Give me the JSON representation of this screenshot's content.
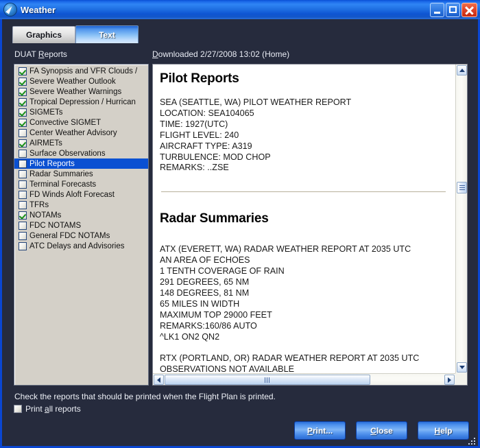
{
  "window": {
    "title": "Weather",
    "icon": "weather-compass-icon",
    "minimize_label": "Minimize",
    "maximize_label": "Maximize",
    "close_label": "Close",
    "accent_color": "#0a4fd4",
    "background_color": "#262b3d"
  },
  "tabs": [
    {
      "label": "Graphics",
      "active": false
    },
    {
      "label": "Text",
      "active": true
    }
  ],
  "labels": {
    "duat_reports": "DUAT Reports",
    "duat_reports_accel_prefix": "DUAT ",
    "duat_reports_accel_char": "R",
    "duat_reports_accel_suffix": "eports",
    "downloaded_accel_char": "D",
    "downloaded_rest": "ownloaded 2/27/2008 13:02 (Home)"
  },
  "report_list": {
    "selected_index": 9,
    "items": [
      {
        "label": "FA Synopsis and VFR Clouds / ",
        "checked": true
      },
      {
        "label": "Severe Weather Outlook",
        "checked": true
      },
      {
        "label": "Severe Weather Warnings",
        "checked": true
      },
      {
        "label": "Tropical Depression / Hurrican",
        "checked": true
      },
      {
        "label": "SIGMETs",
        "checked": true
      },
      {
        "label": "Convective SIGMET",
        "checked": true
      },
      {
        "label": "Center Weather Advisory",
        "checked": false
      },
      {
        "label": "AIRMETs",
        "checked": true
      },
      {
        "label": "Surface Observations",
        "checked": false
      },
      {
        "label": "Pilot Reports",
        "checked": false
      },
      {
        "label": "Radar Summaries",
        "checked": false
      },
      {
        "label": "Terminal Forecasts",
        "checked": false
      },
      {
        "label": "FD Winds Aloft Forecast",
        "checked": false
      },
      {
        "label": "TFRs",
        "checked": false
      },
      {
        "label": "NOTAMs",
        "checked": true
      },
      {
        "label": "FDC NOTAMS",
        "checked": false
      },
      {
        "label": "General FDC NOTAMs",
        "checked": false
      },
      {
        "label": "ATC Delays and Advisories",
        "checked": false
      }
    ]
  },
  "document": {
    "sections": [
      {
        "heading": "Pilot Reports",
        "lines": [
          "SEA (SEATTLE, WA) PILOT WEATHER REPORT",
          "LOCATION: SEA104065",
          "TIME: 1927(UTC)",
          "FLIGHT LEVEL: 240",
          "AIRCRAFT TYPE: A319",
          "TURBULENCE: MOD CHOP",
          "REMARKS: ..ZSE"
        ]
      },
      {
        "heading": "Radar Summaries",
        "lines": [
          "ATX (EVERETT, WA) RADAR WEATHER REPORT AT 2035 UTC",
          "AN AREA OF ECHOES",
          "1 TENTH COVERAGE OF RAIN",
          "291 DEGREES, 65 NM",
          "148 DEGREES, 81 NM",
          "65 MILES IN WIDTH",
          "MAXIMUM TOP 29000 FEET",
          "REMARKS:160/86 AUTO",
          "^LK1 ON2 QN2",
          "",
          "RTX (PORTLAND, OR) RADAR WEATHER REPORT AT 2035 UTC",
          "OBSERVATIONS NOT AVAILABLE"
        ]
      }
    ]
  },
  "scrollbars": {
    "vertical": {
      "thumb_top_pct": 37,
      "up_arrow": "scroll-up-icon",
      "down_arrow": "scroll-down-icon"
    },
    "horizontal": {
      "thumb_width_pct": 73,
      "left_arrow": "scroll-left-icon",
      "right_arrow": "scroll-right-icon"
    }
  },
  "footer": {
    "hint": "Check the reports that should be printed when the Flight Plan is printed.",
    "print_all": {
      "prefix": "Print ",
      "accel_char": "a",
      "suffix": "ll reports",
      "checked": false
    }
  },
  "buttons": [
    {
      "accel_char": "P",
      "rest": "rint...",
      "name": "print-button"
    },
    {
      "accel_char": "C",
      "rest": "lose",
      "name": "close-button"
    },
    {
      "accel_char": "H",
      "rest": "elp",
      "name": "help-button"
    }
  ]
}
